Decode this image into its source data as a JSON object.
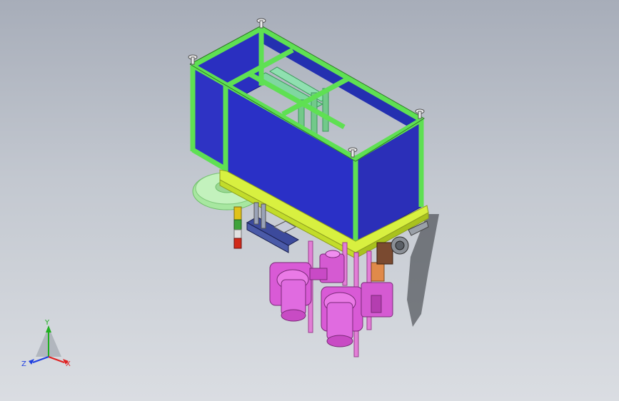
{
  "viewport": {
    "background": "#b9bec7"
  },
  "model": {
    "frame_color": "#5fe053",
    "panel_color": "#2a2fc0",
    "base_plate_color": "#dff54a",
    "pump_color": "#d95ad6",
    "rod_color": "#e27ed6",
    "disc_color": "#b8eeb0",
    "cylinder_colors": [
      "#e0c21a",
      "#3fa33a",
      "#d12a1a"
    ],
    "actuator_color": "#3c4a9c",
    "bracket_color": "#e08a4a"
  },
  "triad": {
    "x_label": "X",
    "y_label": "Y",
    "z_label": "Z",
    "x_color": "#e02020",
    "y_color": "#20b020",
    "z_color": "#2040e0"
  }
}
